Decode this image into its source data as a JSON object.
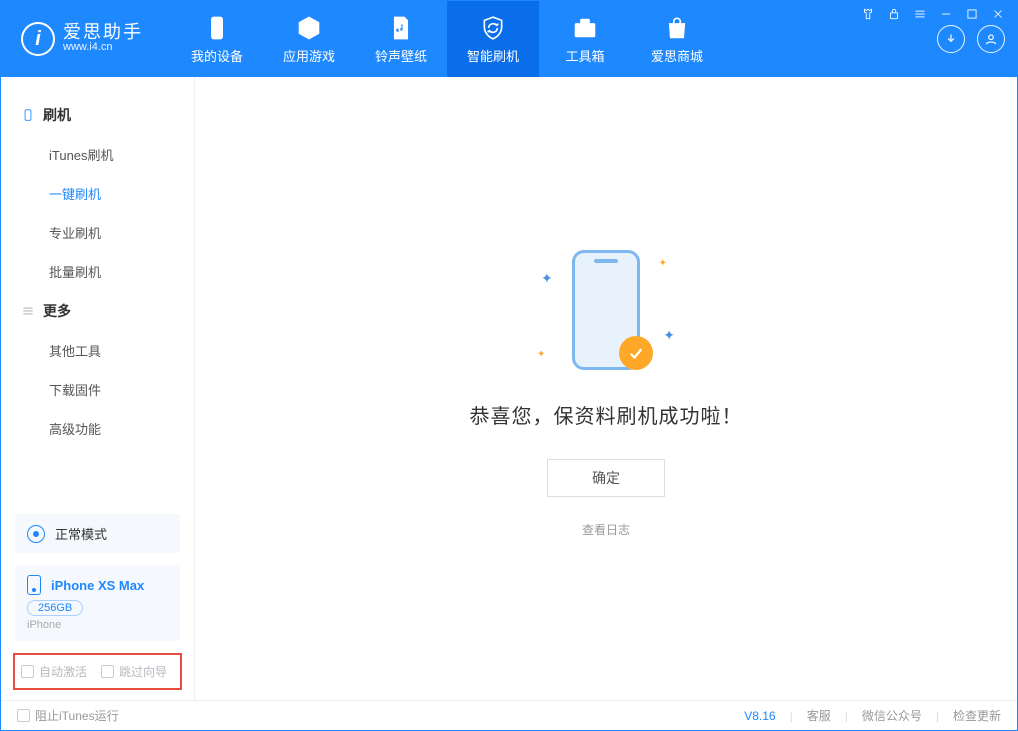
{
  "brand": {
    "name": "爱思助手",
    "domain": "www.i4.cn"
  },
  "nav": {
    "items": [
      {
        "label": "我的设备"
      },
      {
        "label": "应用游戏"
      },
      {
        "label": "铃声壁纸"
      },
      {
        "label": "智能刷机"
      },
      {
        "label": "工具箱"
      },
      {
        "label": "爱思商城"
      }
    ]
  },
  "sidebar": {
    "flash_header": "刷机",
    "flash_items": [
      {
        "label": "iTunes刷机"
      },
      {
        "label": "一键刷机"
      },
      {
        "label": "专业刷机"
      },
      {
        "label": "批量刷机"
      }
    ],
    "more_header": "更多",
    "more_items": [
      {
        "label": "其他工具"
      },
      {
        "label": "下载固件"
      },
      {
        "label": "高级功能"
      }
    ],
    "mode_label": "正常模式",
    "device_name": "iPhone XS Max",
    "device_capacity": "256GB",
    "device_type": "iPhone",
    "auto_activate": "自动激活",
    "skip_guide": "跳过向导"
  },
  "main": {
    "success_msg": "恭喜您，保资料刷机成功啦！",
    "ok_btn": "确定",
    "view_log": "查看日志"
  },
  "footer": {
    "block_itunes": "阻止iTunes运行",
    "version": "V8.16",
    "support": "客服",
    "wechat": "微信公众号",
    "check_update": "检查更新"
  }
}
